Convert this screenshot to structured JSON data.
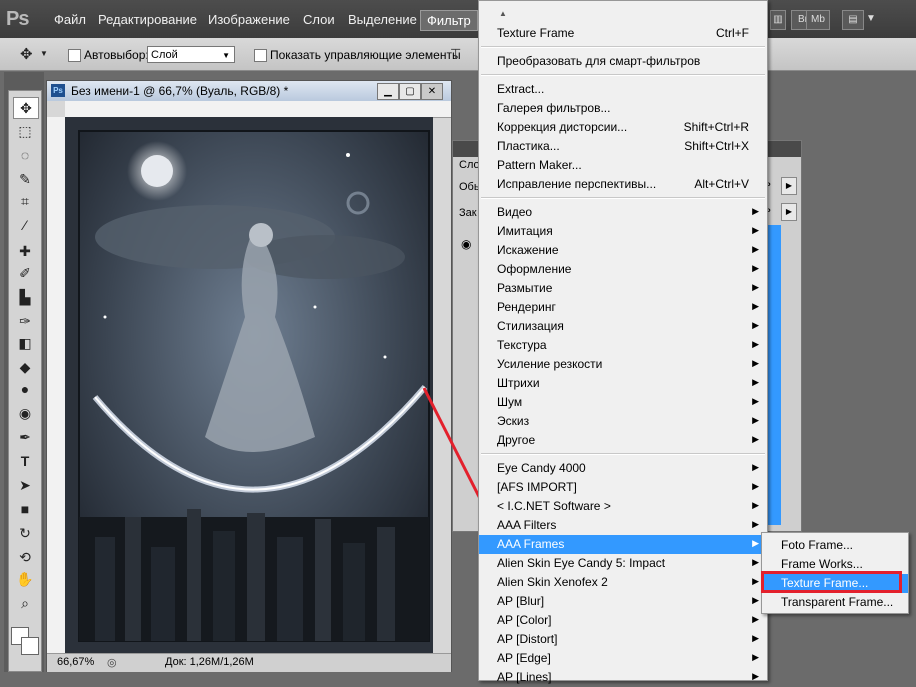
{
  "app": {
    "logo": "Ps"
  },
  "menubar": {
    "items": [
      "Файл",
      "Редактирование",
      "Изображение",
      "Слои",
      "Выделение"
    ],
    "active": "Фильтр",
    "right_buttons": [
      "Br",
      "Mb"
    ]
  },
  "options_bar": {
    "autoselect_label": "Автовыбор:",
    "autoselect_value": "Слой",
    "show_controls_label": "Показать управляющие элементы"
  },
  "document": {
    "title": "Без имени-1 @ 66,7% (Вуаль, RGB/8) *",
    "zoom": "66,67%",
    "doc_size": "Док: 1,26M/1,26M"
  },
  "layers_panel": {
    "title_fragment": "Сло",
    "row1": "Обь",
    "row2": "Зак",
    "right_row1": "ь",
    "right_row2": "ь"
  },
  "filter_menu": {
    "groups": [
      [
        {
          "label": "Texture Frame",
          "shortcut": "Ctrl+F"
        }
      ],
      [
        {
          "label": "Преобразовать для смарт-фильтров"
        }
      ],
      [
        {
          "label": "Extract..."
        },
        {
          "label": "Галерея фильтров..."
        },
        {
          "label": "Коррекция дисторсии...",
          "shortcut": "Shift+Ctrl+R"
        },
        {
          "label": "Пластика...",
          "shortcut": "Shift+Ctrl+X"
        },
        {
          "label": "Pattern Maker..."
        },
        {
          "label": "Исправление перспективы...",
          "shortcut": "Alt+Ctrl+V"
        }
      ],
      [
        {
          "label": "Видео",
          "sub": true
        },
        {
          "label": "Имитация",
          "sub": true
        },
        {
          "label": "Искажение",
          "sub": true
        },
        {
          "label": "Оформление",
          "sub": true
        },
        {
          "label": "Размытие",
          "sub": true
        },
        {
          "label": "Рендеринг",
          "sub": true
        },
        {
          "label": "Стилизация",
          "sub": true
        },
        {
          "label": "Текстура",
          "sub": true
        },
        {
          "label": "Усиление резкости",
          "sub": true
        },
        {
          "label": "Штрихи",
          "sub": true
        },
        {
          "label": "Шум",
          "sub": true
        },
        {
          "label": "Эскиз",
          "sub": true
        },
        {
          "label": "Другое",
          "sub": true
        }
      ],
      [
        {
          "label": " Eye Candy 4000",
          "sub": true
        },
        {
          "label": "[AFS IMPORT]",
          "sub": true
        },
        {
          "label": "< I.C.NET Software >",
          "sub": true
        },
        {
          "label": "AAA Filters",
          "sub": true
        },
        {
          "label": "AAA Frames",
          "sub": true,
          "highlight": true
        },
        {
          "label": "Alien Skin Eye Candy 5: Impact",
          "sub": true
        },
        {
          "label": "Alien Skin Xenofex 2",
          "sub": true
        },
        {
          "label": "AP [Blur]",
          "sub": true
        },
        {
          "label": "AP [Color]",
          "sub": true
        },
        {
          "label": "AP [Distort]",
          "sub": true
        },
        {
          "label": "AP [Edge]",
          "sub": true
        },
        {
          "label": "AP [Lines]",
          "sub": true
        }
      ]
    ]
  },
  "submenu": {
    "items": [
      "Foto Frame...",
      "Frame Works...",
      "Texture Frame...",
      "Transparent Frame..."
    ],
    "selected_index": 2
  },
  "colors": {
    "highlight": "#3399ff",
    "annotation_red": "#e3202c"
  }
}
